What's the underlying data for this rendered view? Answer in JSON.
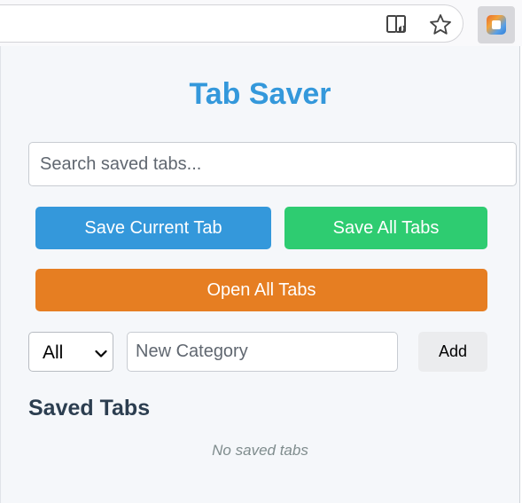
{
  "browser": {
    "icons": [
      "reader-view-icon",
      "bookmark-star-icon",
      "tab-saver-extension-icon"
    ]
  },
  "popup": {
    "title": "Tab Saver",
    "search_placeholder": "Search saved tabs...",
    "buttons": {
      "save_current": "Save Current Tab",
      "save_all": "Save All Tabs",
      "open_all": "Open All Tabs"
    },
    "category_select": {
      "selected": "All"
    },
    "new_category_placeholder": "New Category",
    "add_label": "Add",
    "saved_tabs_heading": "Saved Tabs",
    "empty_message": "No saved tabs"
  },
  "colors": {
    "title": "#3498db",
    "save_current": "#3498db",
    "save_all": "#2ecc71",
    "open_all": "#e67e22",
    "heading": "#2c3e50"
  }
}
